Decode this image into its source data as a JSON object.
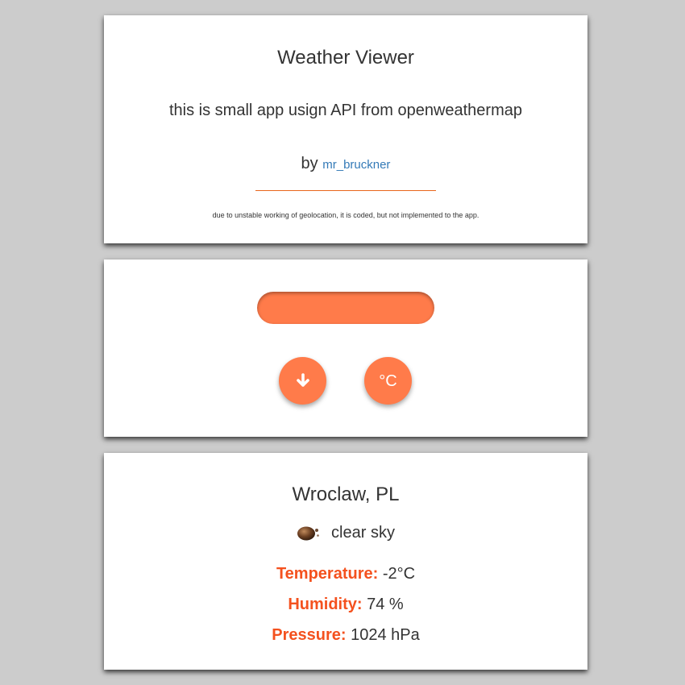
{
  "intro": {
    "title": "Weather Viewer",
    "description": "this is small app usign API from openweathermap",
    "by_label": "by",
    "author": "mr_bruckner",
    "note": "due to unstable working of geolocation, it is coded, but not implemented to the app."
  },
  "controls": {
    "city_input_value": "",
    "city_input_placeholder": "",
    "fetch_icon": "arrow-down-icon",
    "unit_label": "°C",
    "accent_color": "#ff7b4a"
  },
  "weather": {
    "city": "Wroclaw, PL",
    "icon": "clear-sky-icon",
    "condition": "clear sky",
    "temperature_label": "Temperature:",
    "temperature_value": "-2°C",
    "humidity_label": "Humidity:",
    "humidity_value": "74 %",
    "pressure_label": "Pressure:",
    "pressure_value": "1024 hPa",
    "label_color": "#f4511e"
  }
}
